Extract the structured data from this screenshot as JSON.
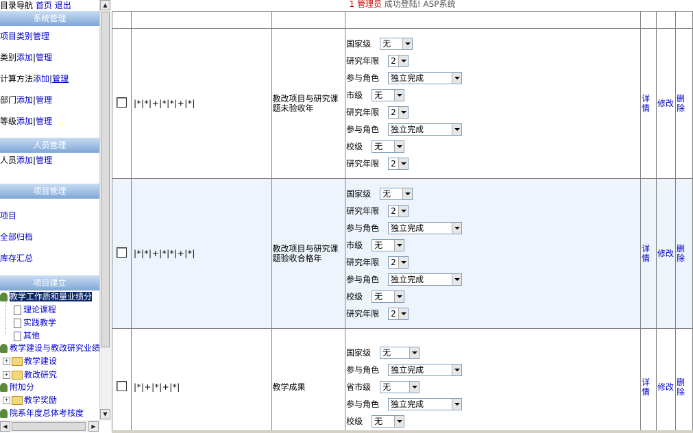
{
  "left": {
    "topnav": {
      "label": "目录导航",
      "home": "首页",
      "logout": "退出"
    },
    "sections": [
      {
        "title": "系统管理"
      },
      {
        "title": "人员管理"
      },
      {
        "title": "项目管理"
      },
      {
        "title": "项目建立"
      }
    ],
    "system_items": [
      {
        "text": "项目类别管理"
      },
      {
        "prefix": "类别",
        "add": "添加",
        "sep": "|",
        "manage": "管理"
      },
      {
        "prefix": "计算方法",
        "add": "添加",
        "sep": "|",
        "manage": "管理"
      },
      {
        "prefix": "部门",
        "add": "添加",
        "sep": "|",
        "manage": "管理"
      },
      {
        "prefix": "等级",
        "add": "添加",
        "sep": "|",
        "manage": "管理"
      }
    ],
    "person_items": [
      {
        "prefix": "人员",
        "add": "添加",
        "sep": "|",
        "manage": "管理"
      }
    ],
    "project_items": [
      "项目",
      "全部归档",
      "库存汇总"
    ],
    "tree": [
      "教学工作质和量业绩分",
      "理论课程",
      "实践教学",
      "其他",
      "教学建设与教改研究业绩",
      "教学建设",
      "教改研究",
      "附加分",
      "教学奖励",
      "院系年度总体考核度"
    ]
  },
  "header": {
    "count": "1",
    "role": "管理员",
    "msg": "成功登陆! ASP系统"
  },
  "rows": [
    {
      "code": "|*|*|+|*|*|+|*|",
      "name": "教改项目与研究课题未验收年",
      "fields": [
        {
          "label": "国家级",
          "value": "无"
        },
        {
          "label": "研究年限",
          "value": "2"
        },
        {
          "label": "参与角色",
          "value": "独立完成"
        },
        {
          "label": "市级",
          "value": "无"
        },
        {
          "label": "研究年限",
          "value": "2"
        },
        {
          "label": "参与角色",
          "value": "独立完成"
        },
        {
          "label": "校级",
          "value": "无"
        },
        {
          "label": "研究年限",
          "value": "2"
        }
      ],
      "detail": "详情",
      "edit": "修改",
      "delete": "删除"
    },
    {
      "code": "|*|*|+|*|*|+|*|",
      "name": "教改项目与研究课题验收合格年",
      "fields": [
        {
          "label": "国家级",
          "value": "无"
        },
        {
          "label": "研究年限",
          "value": "2"
        },
        {
          "label": "参与角色",
          "value": "独立完成"
        },
        {
          "label": "市级",
          "value": "无"
        },
        {
          "label": "研究年限",
          "value": "2"
        },
        {
          "label": "参与角色",
          "value": "独立完成"
        },
        {
          "label": "校级",
          "value": "无"
        },
        {
          "label": "研究年限",
          "value": "2"
        }
      ],
      "detail": "详情",
      "edit": "修改",
      "delete": "删除"
    },
    {
      "code": "|*|+|*|+|*|",
      "name": "教学成果",
      "fields": [
        {
          "label": "国家级",
          "value": "无"
        },
        {
          "label": "参与角色",
          "value": "独立完成"
        },
        {
          "label": "省市级",
          "value": "无"
        },
        {
          "label": "参与角色",
          "value": "独立完成"
        },
        {
          "label": "校级",
          "value": "无"
        }
      ],
      "detail": "详情",
      "edit": "修改",
      "delete": "删除"
    }
  ],
  "colors": {
    "section_top": "#c9dcf3",
    "section_bottom": "#7ea6d6",
    "link": "#0000cc",
    "alt_row": "#eef4fb",
    "red": "#cc0000"
  }
}
